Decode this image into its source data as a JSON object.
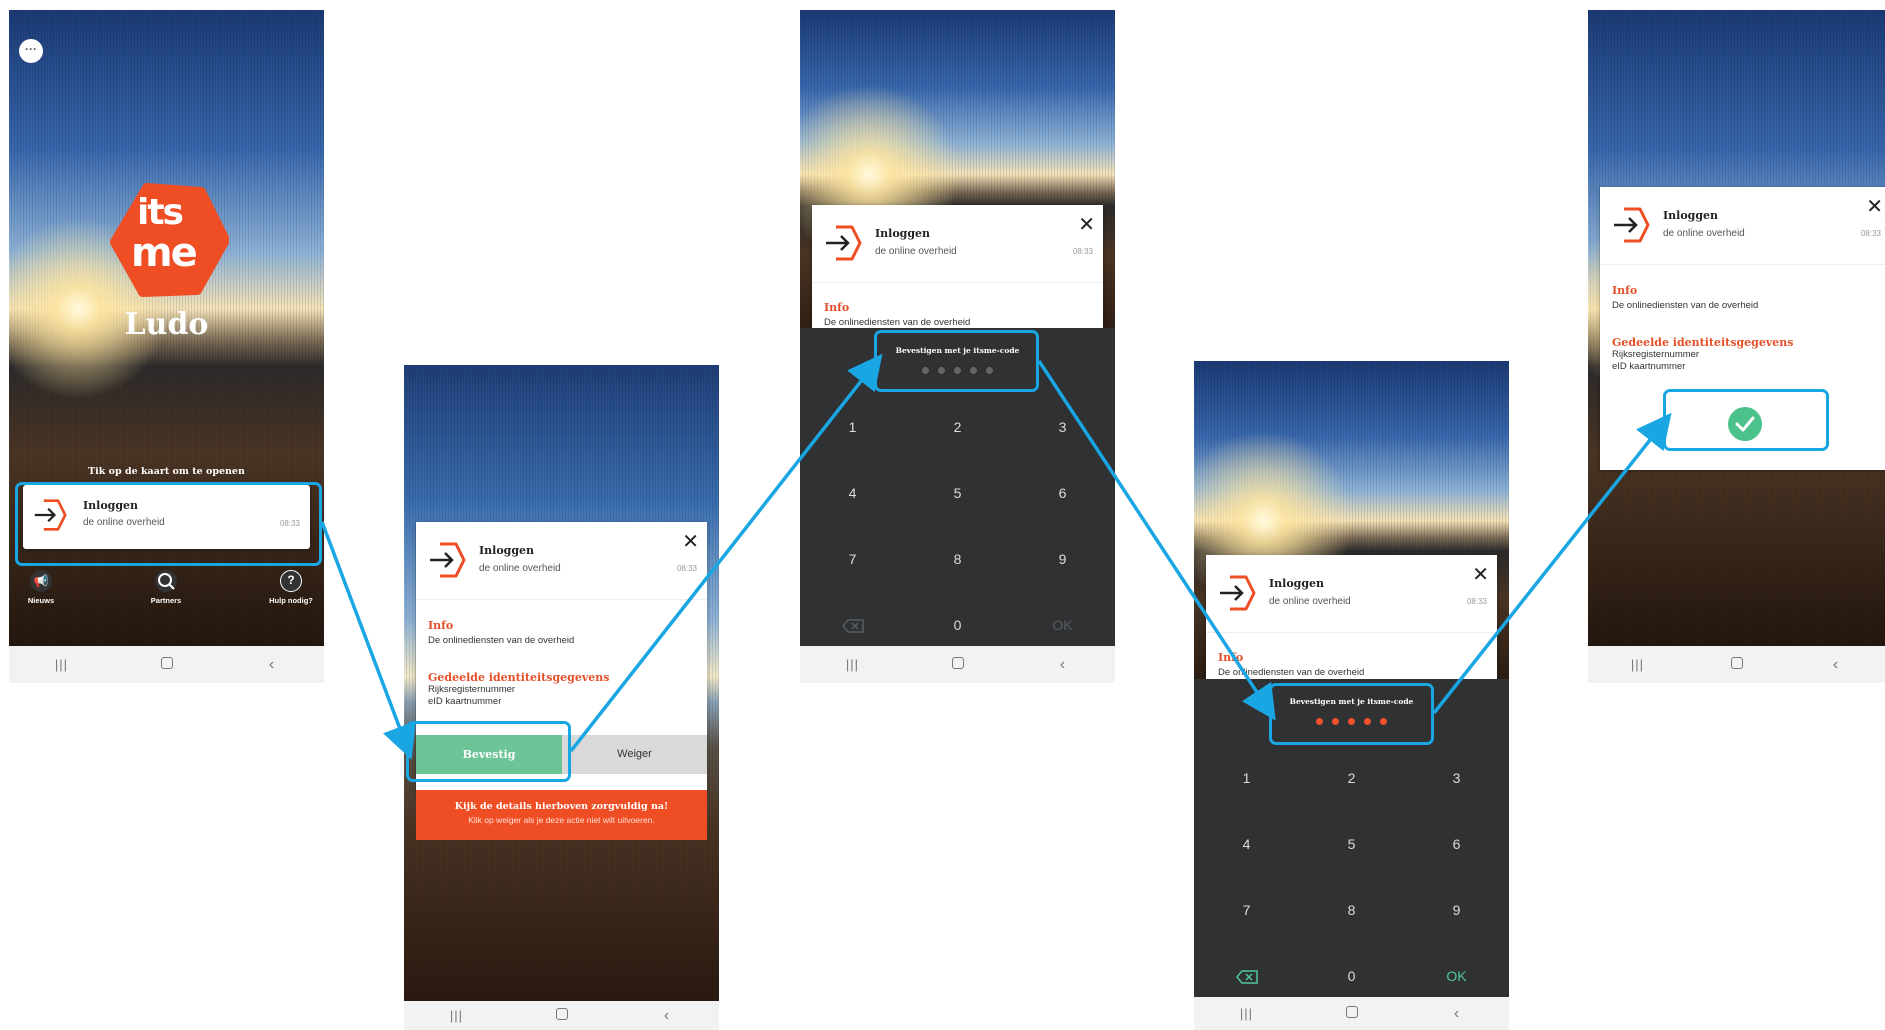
{
  "colors": {
    "accent": "#19a6e3",
    "brand_orange": "#ef4d24",
    "confirm_green": "#6cc497",
    "success_green": "#4cc18b"
  },
  "screen1": {
    "chat_icon": "chat-bubble-icon",
    "logo_line1": "its",
    "logo_line2": "me",
    "user_name": "Ludo",
    "tap_hint": "Tik op de kaart om te openen",
    "card": {
      "title": "Inloggen",
      "subtitle": "de online overheid",
      "time": "08:33"
    },
    "nav": [
      {
        "icon": "megaphone-icon",
        "label": "Nieuws"
      },
      {
        "icon": "search-icon",
        "label": "Partners"
      },
      {
        "icon": "help-icon",
        "label": "Hulp nodig?"
      }
    ]
  },
  "screen2": {
    "card": {
      "title": "Inloggen",
      "subtitle": "de online overheid",
      "time": "08:33"
    },
    "info_heading": "Info",
    "info_text": "De onlinediensten van de overheid",
    "shared_heading": "Gedeelde identiteitsgegevens",
    "shared_items": [
      "Rijksregisternummer",
      "eID kaartnummer"
    ],
    "confirm_label": "Bevestig",
    "reject_label": "Weiger",
    "warning_title": "Kijk de details hierboven zorgvuldig na!",
    "warning_text": "Klik op weiger als je deze actie niet wilt uitvoeren."
  },
  "screen3": {
    "card": {
      "title": "Inloggen",
      "subtitle": "de online overheid",
      "time": "08:33"
    },
    "info_heading": "Info",
    "info_text": "De onlinediensten van de overheid",
    "pin_label": "Bevestigen met je itsme-code",
    "pin_filled": 0,
    "keys": [
      "1",
      "2",
      "3",
      "4",
      "5",
      "6",
      "7",
      "8",
      "9",
      "",
      "0",
      "OK"
    ]
  },
  "screen4": {
    "card": {
      "title": "Inloggen",
      "subtitle": "de online overheid",
      "time": "08:33"
    },
    "info_heading": "Info",
    "info_text": "De onlinediensten van de overheid",
    "pin_label": "Bevestigen met je itsme-code",
    "pin_filled": 5,
    "keys": [
      "1",
      "2",
      "3",
      "4",
      "5",
      "6",
      "7",
      "8",
      "9",
      "",
      "0",
      "OK"
    ]
  },
  "screen5": {
    "card": {
      "title": "Inloggen",
      "subtitle": "de online overheid",
      "time": "08:33"
    },
    "info_heading": "Info",
    "info_text": "De onlinediensten van de overheid",
    "shared_heading": "Gedeelde identiteitsgegevens",
    "shared_items": [
      "Rijksregisternummer",
      "eID kaartnummer"
    ],
    "success_icon": "checkmark-circle-icon"
  },
  "system_nav": {
    "recent": "|||",
    "back": "‹"
  }
}
